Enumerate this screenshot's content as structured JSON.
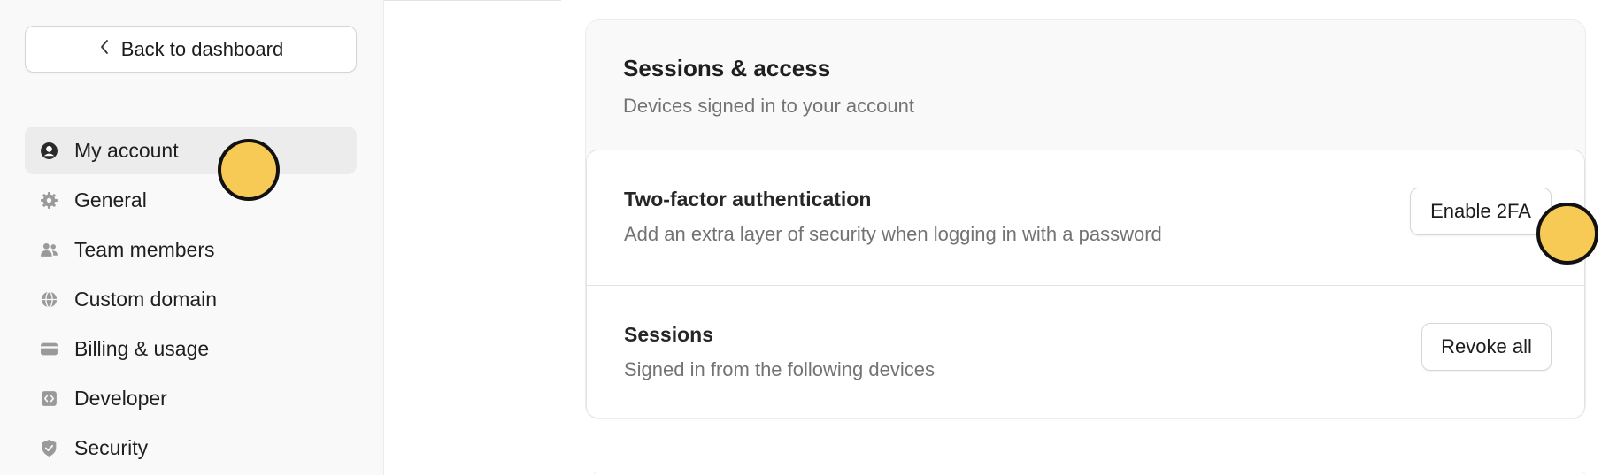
{
  "sidebar": {
    "back_label": "Back to dashboard",
    "items": [
      {
        "label": "My account",
        "icon": "user-circle-icon",
        "active": true
      },
      {
        "label": "General",
        "icon": "gear-icon"
      },
      {
        "label": "Team members",
        "icon": "users-icon"
      },
      {
        "label": "Custom domain",
        "icon": "globe-icon"
      },
      {
        "label": "Billing & usage",
        "icon": "credit-card-icon"
      },
      {
        "label": "Developer",
        "icon": "code-icon"
      },
      {
        "label": "Security",
        "icon": "shield-check-icon"
      }
    ]
  },
  "main": {
    "section_title": "Sessions & access",
    "section_subtitle": "Devices signed in to your account",
    "rows": [
      {
        "title": "Two-factor authentication",
        "description": "Add an extra layer of security when logging in with a password",
        "button_label": "Enable 2FA"
      },
      {
        "title": "Sessions",
        "description": "Signed in from the following devices",
        "button_label": "Revoke all"
      }
    ]
  },
  "colors": {
    "sidebar_bg": "#f9f9f9",
    "active_item_bg": "#ececec",
    "cursor_fill": "#f6ca55",
    "muted_text": "#737373"
  }
}
